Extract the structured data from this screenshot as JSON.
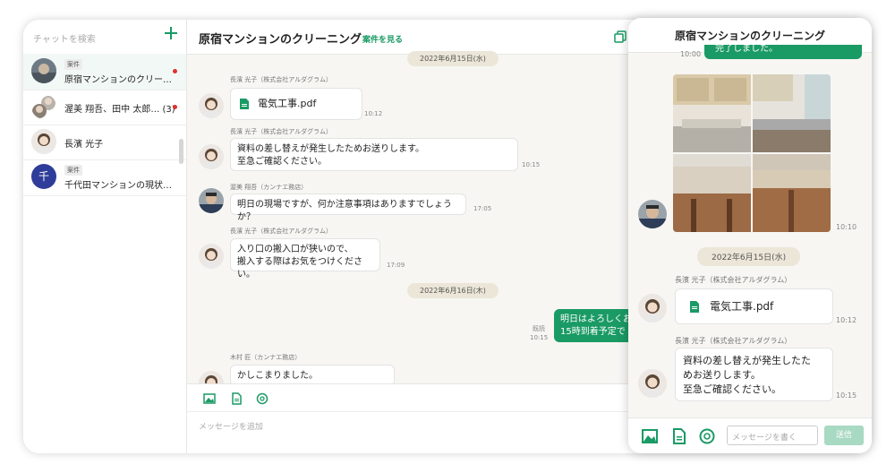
{
  "sidebar": {
    "search_placeholder": "チャットを検索",
    "items": [
      {
        "badge": "案件",
        "name": "原宿マンションのクリー…",
        "unread": true
      },
      {
        "badge": "",
        "name": "渥美 翔吾、田中 太郎… (3)",
        "unread": true
      },
      {
        "badge": "",
        "name": "長濱 光子",
        "unread": false
      },
      {
        "badge": "案件",
        "name": "千代田マンションの現状…",
        "unread": false,
        "avatar_letter": "千"
      }
    ]
  },
  "main": {
    "title": "原宿マンションのクリーニング",
    "view_link": "案件を見る",
    "messages": [
      {
        "date": "2022年6月15日(水)"
      },
      {
        "sender": "長濱 光子（株式会社アルダグラム）",
        "file": "電気工事.pdf",
        "time": "10:12"
      },
      {
        "sender": "長濱 光子（株式会社アルダグラム）",
        "lines": [
          "資料の差し替えが発生したためお送りします。",
          "至急ご確認ください。"
        ],
        "time": "10:15"
      },
      {
        "sender": "渥美 翔吾（カンナエ務店）",
        "lines": [
          "明日の現場ですが、何か注意事項はありますでしょうか？"
        ],
        "time": "17:05"
      },
      {
        "sender": "長濱 光子（株式会社アルダグラム）",
        "lines": [
          "入り口の搬入口が狭いので、",
          "搬入する際はお気をつけください。"
        ],
        "time": "17:09"
      },
      {
        "date": "2022年6月16日(木)"
      },
      {
        "own": true,
        "read": "既読",
        "time": "10:15",
        "lines": [
          "明日はよろしくお",
          "15時到着予定で"
        ]
      },
      {
        "sender": "木村 匠（カンナエ務店）",
        "lines": [
          "かしこまりました。"
        ]
      }
    ],
    "input_placeholder": "メッセージを追加"
  },
  "phone": {
    "title": "原宿マンションのクリーニング",
    "top_time": "10:00",
    "top_partial": "完了しました。",
    "photo_time": "10:10",
    "date": "2022年6月15日(水)",
    "msg1": {
      "sender": "長濱 光子（株式会社アルダグラム）",
      "file": "電気工事.pdf",
      "time": "10:12"
    },
    "msg2": {
      "sender": "長濱 光子（株式会社アルダグラム）",
      "lines": [
        "資料の差し替えが発生したた",
        "めお送りします。",
        "至急ご確認ください。"
      ],
      "time": "10:15"
    },
    "input_placeholder": "メッセージを書く",
    "send_label": "送信"
  },
  "colors": {
    "accent": "#1a9a64",
    "unread": "#e0322c",
    "date_pill": "#ece6d8"
  },
  "icons": [
    "plus-icon",
    "copy-icon",
    "image-icon",
    "file-icon",
    "mention-icon",
    "pdf-file-icon"
  ]
}
